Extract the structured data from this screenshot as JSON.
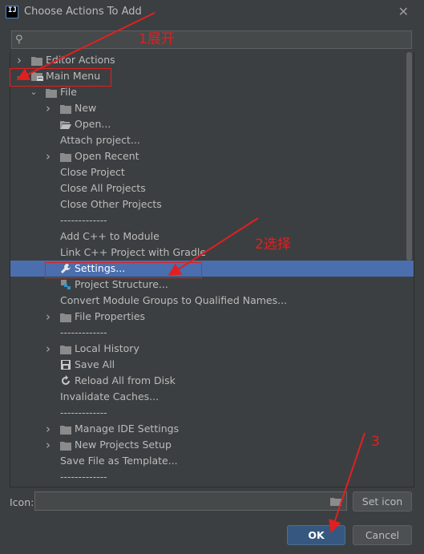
{
  "window": {
    "title": "Choose Actions To Add",
    "logo_text": "IJ"
  },
  "search": {
    "placeholder": ""
  },
  "tree": {
    "items": [
      {
        "label": "Editor Actions",
        "level": 0,
        "arrow": "right",
        "icon": "folder-icon"
      },
      {
        "label": "Main Menu",
        "level": 0,
        "arrow": "down",
        "icon": "menu-folder-icon"
      },
      {
        "label": "File",
        "level": 1,
        "arrow": "down",
        "icon": "folder-icon"
      },
      {
        "label": "New",
        "level": 2,
        "arrow": "right",
        "icon": "folder-icon"
      },
      {
        "label": "Open...",
        "level": 2,
        "arrow": "",
        "icon": "open-folder-icon"
      },
      {
        "label": "Attach project...",
        "level": 2,
        "arrow": "",
        "icon": ""
      },
      {
        "label": "Open Recent",
        "level": 2,
        "arrow": "right",
        "icon": "folder-icon"
      },
      {
        "label": "Close Project",
        "level": 2,
        "arrow": "",
        "icon": ""
      },
      {
        "label": "Close All Projects",
        "level": 2,
        "arrow": "",
        "icon": ""
      },
      {
        "label": "Close Other Projects",
        "level": 2,
        "arrow": "",
        "icon": ""
      },
      {
        "label": "-------------",
        "level": 2,
        "arrow": "",
        "icon": ""
      },
      {
        "label": "Add C++ to Module",
        "level": 2,
        "arrow": "",
        "icon": ""
      },
      {
        "label": "Link C++ Project with Gradle",
        "level": 2,
        "arrow": "",
        "icon": ""
      },
      {
        "label": "Settings...",
        "level": 2,
        "arrow": "",
        "icon": "wrench-icon",
        "selected": true
      },
      {
        "label": "Project Structure...",
        "level": 2,
        "arrow": "",
        "icon": "project-structure-icon"
      },
      {
        "label": "Convert Module Groups to Qualified Names...",
        "level": 2,
        "arrow": "",
        "icon": ""
      },
      {
        "label": "File Properties",
        "level": 2,
        "arrow": "right",
        "icon": "folder-icon"
      },
      {
        "label": "-------------",
        "level": 2,
        "arrow": "",
        "icon": ""
      },
      {
        "label": "Local History",
        "level": 2,
        "arrow": "right",
        "icon": "folder-icon"
      },
      {
        "label": "Save All",
        "level": 2,
        "arrow": "",
        "icon": "save-icon"
      },
      {
        "label": "Reload All from Disk",
        "level": 2,
        "arrow": "",
        "icon": "reload-icon"
      },
      {
        "label": "Invalidate Caches...",
        "level": 2,
        "arrow": "",
        "icon": ""
      },
      {
        "label": "-------------",
        "level": 2,
        "arrow": "",
        "icon": ""
      },
      {
        "label": "Manage IDE Settings",
        "level": 2,
        "arrow": "right",
        "icon": "folder-icon"
      },
      {
        "label": "New Projects Setup",
        "level": 2,
        "arrow": "right",
        "icon": "folder-icon"
      },
      {
        "label": "Save File as Template...",
        "level": 2,
        "arrow": "",
        "icon": ""
      },
      {
        "label": "-------------",
        "level": 2,
        "arrow": "",
        "icon": ""
      }
    ]
  },
  "icon_field": {
    "label": "Icon:",
    "value": ""
  },
  "buttons": {
    "set_icon": "Set icon",
    "ok": "OK",
    "cancel": "Cancel"
  },
  "annotations": {
    "step1": "1展开",
    "step2": "2选择",
    "step3": "3"
  },
  "colors": {
    "background": "#3c3f41",
    "selection": "#4b6eaf",
    "annotation": "#e02020",
    "ok_button": "#365880"
  }
}
